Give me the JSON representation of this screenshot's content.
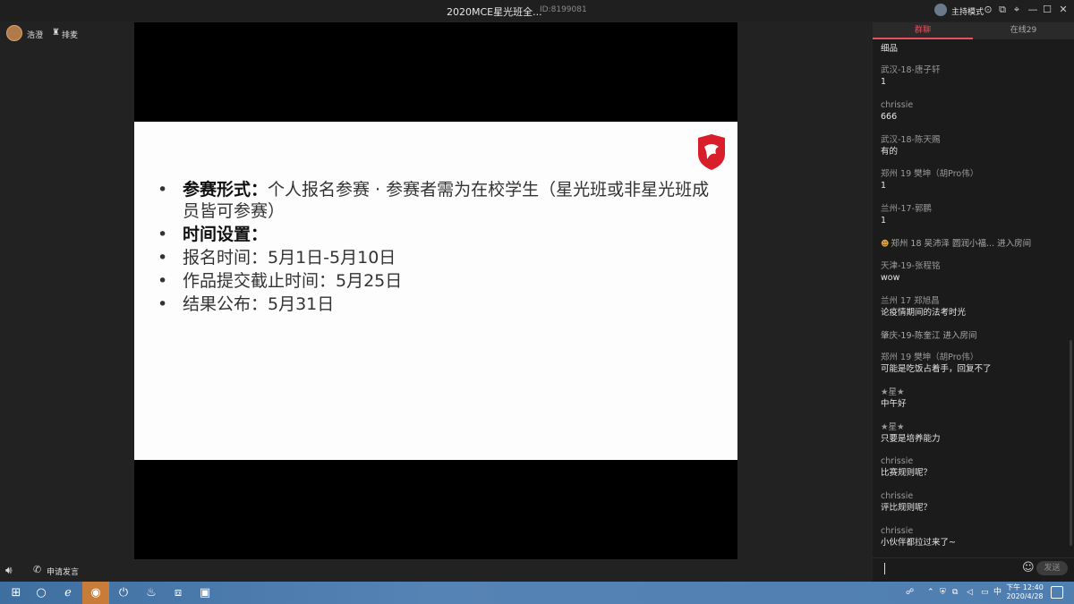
{
  "window": {
    "title": "2020MCE星光班全...",
    "room_id": "ID:8199081",
    "host_mode_label": "主持模式"
  },
  "teacher": {
    "name": "浩澄",
    "rank_label": "排麦"
  },
  "slide": {
    "bullets": [
      {
        "bold": "参赛形式：",
        "text": "个人报名参赛 · 参赛者需为在校学生（星光班或非星光班成员皆可参赛）"
      },
      {
        "bold": "时间设置：",
        "text": ""
      },
      {
        "bold": "",
        "text": "报名时间：5月1日-5月10日"
      },
      {
        "bold": "",
        "text": "作品提交截止时间：5月25日"
      },
      {
        "bold": "",
        "text": "结果公布：5月31日"
      }
    ]
  },
  "controls": {
    "apply_speak_label": "申请发言"
  },
  "chat": {
    "tab_group": "群聊",
    "tab_online": "在线29",
    "messages": [
      {
        "user": "",
        "text": "细品"
      },
      {
        "user": "武汉-18-唐子轩",
        "text": "1"
      },
      {
        "user": "chrissie",
        "text": "666"
      },
      {
        "user": "武汉-18-陈天赐",
        "text": "有的"
      },
      {
        "user": "郑州 19 樊坤（胡Pro伟）",
        "text": "1"
      },
      {
        "user": "兰州-17-郭鹏",
        "text": "1"
      },
      {
        "system": "郑州 18 吴沛泽 圆润小福... 进入房间"
      },
      {
        "user": "天津-19-张程铭",
        "text": "wow"
      },
      {
        "user": "兰州  17  郑旭昌",
        "text": "论疫情期间的法考时光"
      },
      {
        "system": "肇庆-19-陈奎江 进入房间"
      },
      {
        "user": "郑州 19 樊坤（胡Pro伟）",
        "text": "可能是吃饭占着手，回复不了"
      },
      {
        "user": "★星★",
        "text": "中午好"
      },
      {
        "user": "★星★",
        "text": "只要是培养能力"
      },
      {
        "user": "chrissie",
        "text": "比赛规则呢？"
      },
      {
        "user": "chrissie",
        "text": "评比规则呢？"
      },
      {
        "user": "chrissie",
        "text": "小伙伴都拉过来了~"
      }
    ],
    "send_label": "发送"
  },
  "taskbar": {
    "time": "下午 12:40",
    "date": "2020/4/28",
    "ime": "中"
  },
  "colors": {
    "accent": "#e8505b",
    "slide_logo_red": "#d81e2b"
  }
}
